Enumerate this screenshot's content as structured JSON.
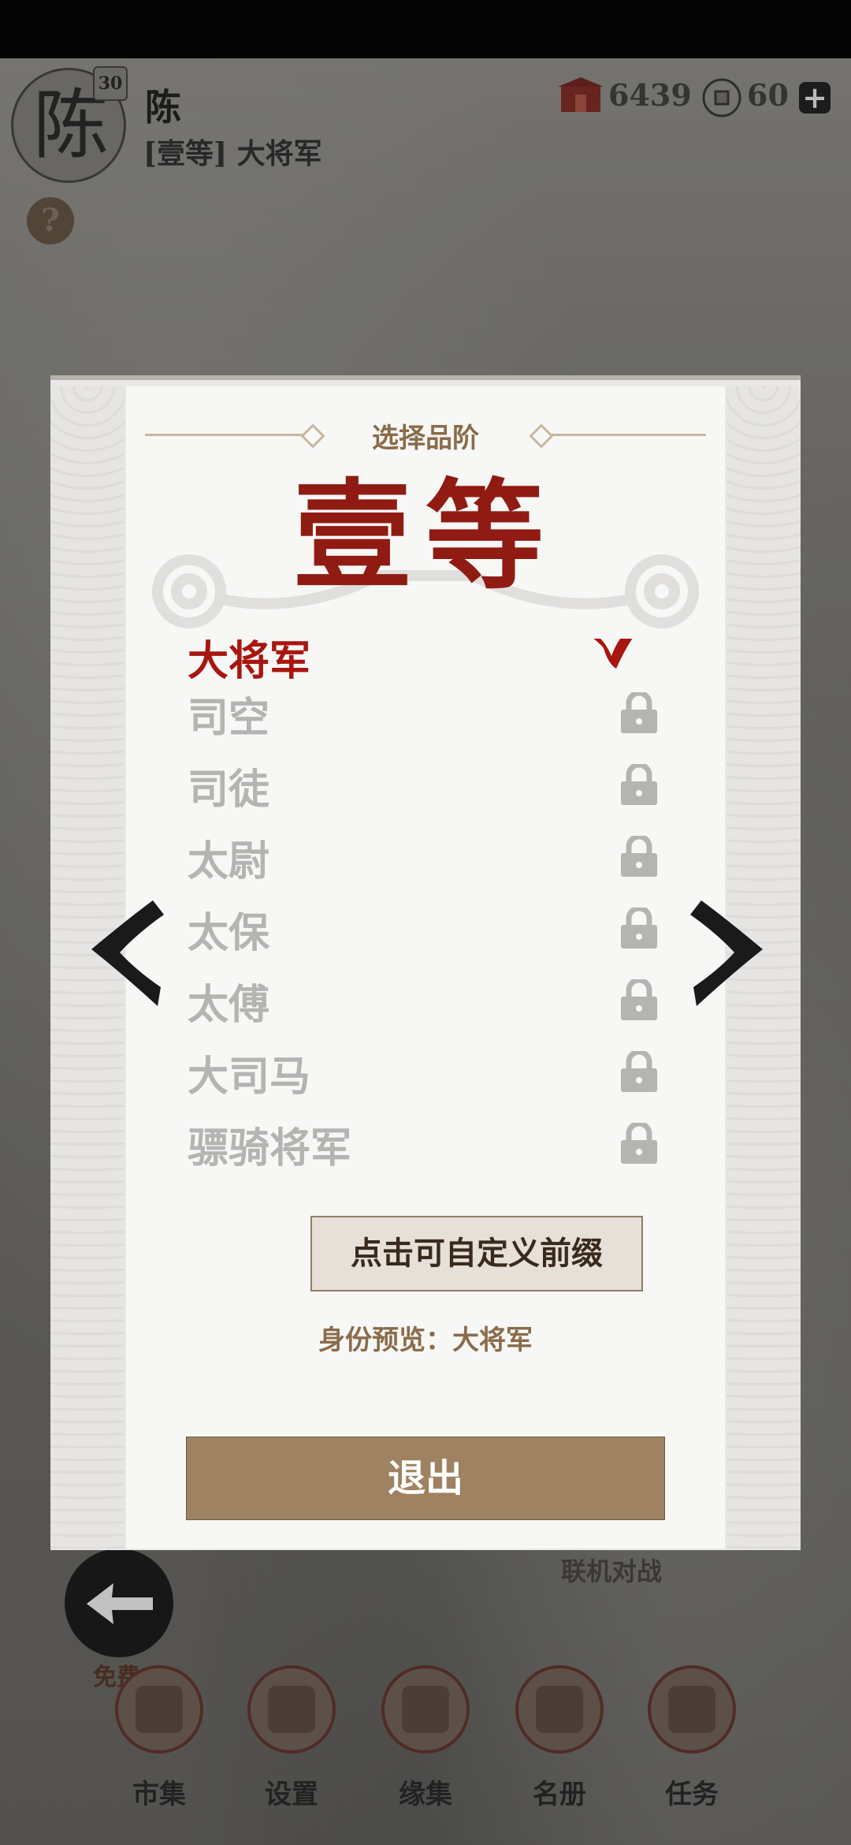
{
  "header": {
    "avatar_char": "陈",
    "level": "30",
    "player_name": "陈",
    "player_title": "[壹等] 大将军",
    "help": "?",
    "resource1_value": "6439",
    "resource1_icon": "ticket-icon",
    "resource2_value": "60",
    "resource2_icon": "coin-icon",
    "add": "+"
  },
  "dialog": {
    "title": "选择品阶",
    "grade": "壹等",
    "ranks": [
      {
        "label": "大将军",
        "state": "selected"
      },
      {
        "label": "司空",
        "state": "locked"
      },
      {
        "label": "司徒",
        "state": "locked"
      },
      {
        "label": "太尉",
        "state": "locked"
      },
      {
        "label": "太保",
        "state": "locked"
      },
      {
        "label": "太傅",
        "state": "locked"
      },
      {
        "label": "大司马",
        "state": "locked"
      },
      {
        "label": "骠骑将军",
        "state": "locked"
      }
    ],
    "custom_button": "点击可自定义前缀",
    "preview": "身份预览：大将军",
    "exit_button": "退出"
  },
  "bottom": {
    "online_label": "联机对战",
    "free_tag": "免费",
    "nav": [
      {
        "label": "市集",
        "icon": "market-icon"
      },
      {
        "label": "设置",
        "icon": "settings-icon"
      },
      {
        "label": "缘集",
        "icon": "collection-icon"
      },
      {
        "label": "名册",
        "icon": "roster-icon"
      },
      {
        "label": "任务",
        "icon": "task-icon"
      }
    ]
  },
  "colors": {
    "accent_red": "#a8160f",
    "brown_button": "#9f8261",
    "locked_gray": "#b4b4b2"
  }
}
